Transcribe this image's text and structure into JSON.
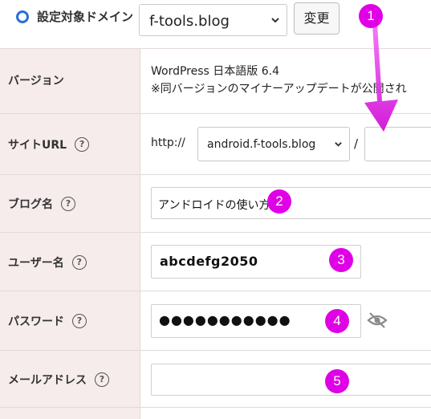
{
  "domain": {
    "label": "設定対象ドメイン",
    "selected": "f-tools.blog",
    "change_button": "変更"
  },
  "rows": {
    "version": {
      "label": "バージョン",
      "line1": "WordPress 日本語版 6.4",
      "line2": "※同バージョンのマイナーアップデートが公開され"
    },
    "site_url": {
      "label": "サイトURL",
      "protocol": "http://",
      "domain_selected": "android.f-tools.blog",
      "separator": "/",
      "path_value": ""
    },
    "blog_name": {
      "label": "ブログ名",
      "value": "アンドロイドの使い方"
    },
    "username": {
      "label": "ユーザー名",
      "value": "abcdefg2050"
    },
    "password": {
      "label": "パスワード",
      "value": "●●●●●●●●●●●"
    },
    "email": {
      "label": "メールアドレス",
      "value": ""
    }
  },
  "help_glyph": "?",
  "badges": [
    "1",
    "2",
    "3",
    "4",
    "5"
  ],
  "colors": {
    "accent": "#2a6fdb",
    "badge": "#e000e6",
    "label_bg": "#f6ecec"
  }
}
